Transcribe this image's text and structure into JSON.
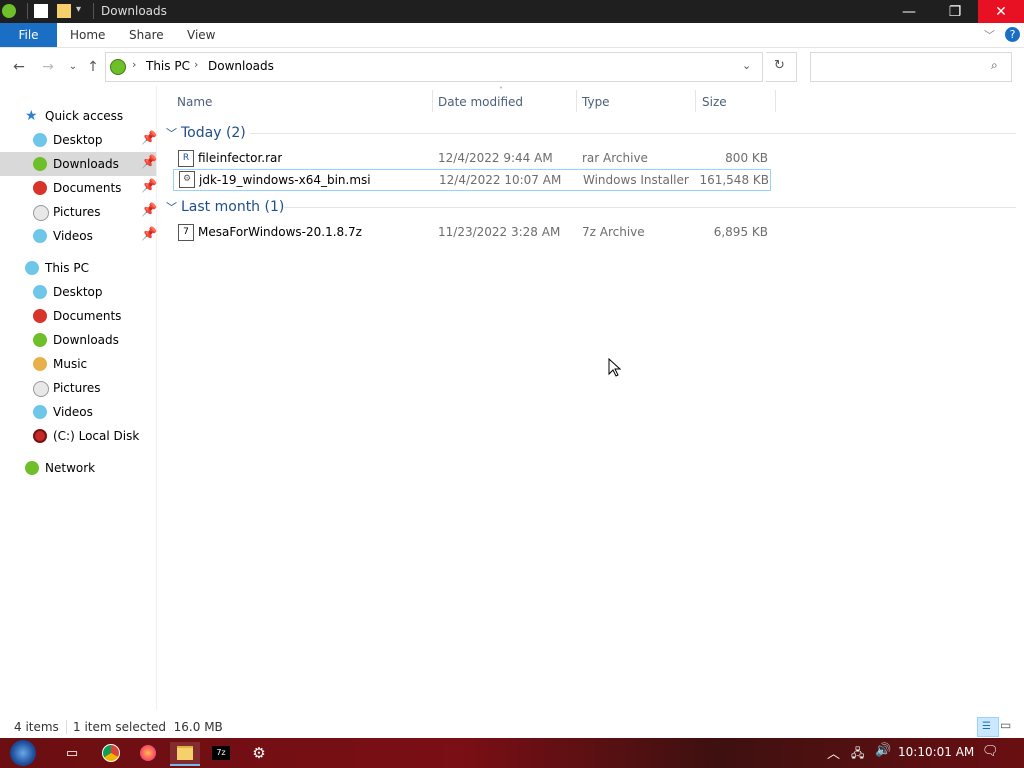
{
  "window": {
    "title": "Downloads"
  },
  "ribbon": {
    "tabs": [
      "File",
      "Home",
      "Share",
      "View"
    ]
  },
  "address": {
    "crumbs": [
      "This PC",
      "Downloads"
    ],
    "search_placeholder": ""
  },
  "sidebar": {
    "quick_access_label": "Quick access",
    "quick_access": [
      {
        "label": "Desktop",
        "icon": "desktop-icon",
        "pinned": true
      },
      {
        "label": "Downloads",
        "icon": "downloads-icon",
        "pinned": true
      },
      {
        "label": "Documents",
        "icon": "documents-icon",
        "pinned": true
      },
      {
        "label": "Pictures",
        "icon": "pictures-icon",
        "pinned": true
      },
      {
        "label": "Videos",
        "icon": "videos-icon",
        "pinned": true
      }
    ],
    "this_pc_label": "This PC",
    "this_pc": [
      {
        "label": "Desktop",
        "icon": "desktop-icon"
      },
      {
        "label": "Documents",
        "icon": "documents-icon"
      },
      {
        "label": "Downloads",
        "icon": "downloads-icon"
      },
      {
        "label": "Music",
        "icon": "music-icon"
      },
      {
        "label": "Pictures",
        "icon": "pictures-icon"
      },
      {
        "label": "Videos",
        "icon": "videos-icon"
      },
      {
        "label": "(C:) Local Disk",
        "icon": "disk-icon"
      }
    ],
    "network_label": "Network"
  },
  "columns": {
    "name": "Name",
    "date": "Date modified",
    "type": "Type",
    "size": "Size"
  },
  "groups": [
    {
      "label": "Today (2)",
      "files": [
        {
          "name": "fileinfector.rar",
          "date": "12/4/2022 9:44 AM",
          "type": "rar Archive",
          "size": "800 KB",
          "icon": "rar-file-icon"
        },
        {
          "name": "jdk-19_windows-x64_bin.msi",
          "date": "12/4/2022 10:07 AM",
          "type": "Windows Installer ...",
          "size": "161,548 KB",
          "icon": "msi-file-icon"
        }
      ]
    },
    {
      "label": "Last month (1)",
      "files": [
        {
          "name": "MesaForWindows-20.1.8.7z",
          "date": "11/23/2022 3:28 AM",
          "type": "7z Archive",
          "size": "6,895 KB",
          "icon": "7z-file-icon"
        }
      ]
    }
  ],
  "status": {
    "items": "4 items",
    "selection": "1 item selected  16.0 MB"
  },
  "taskbar": {
    "clock": "10:10:01 AM"
  },
  "colors": {
    "accent": "#1a6fc4",
    "selection": "#cce8ff",
    "close": "#e81123",
    "taskbar": "#6b0f12"
  }
}
